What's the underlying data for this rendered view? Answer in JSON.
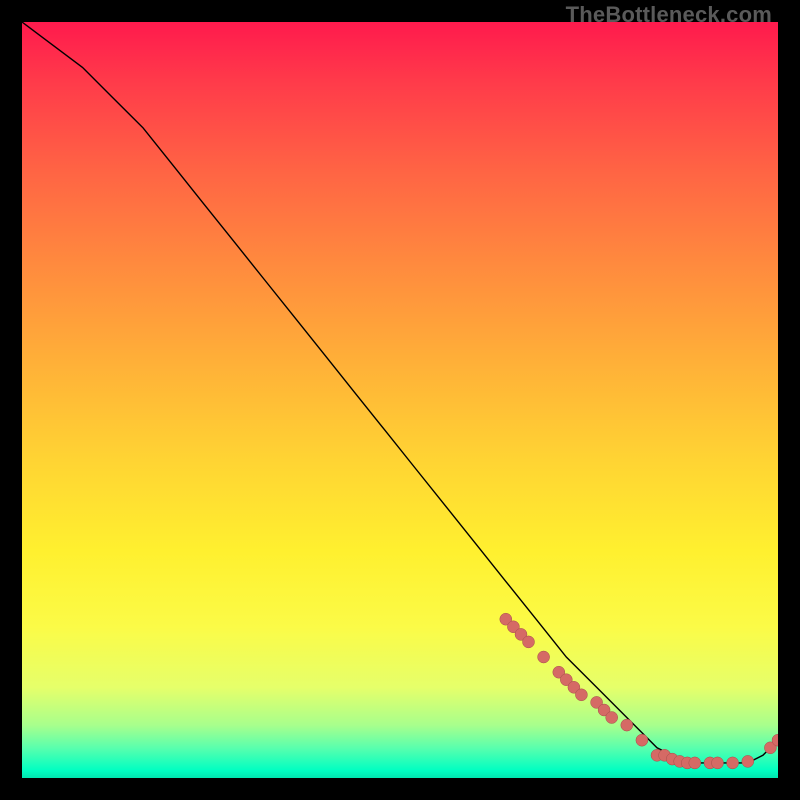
{
  "watermark": "TheBottleneck.com",
  "chart_data": {
    "type": "line",
    "title": "",
    "xlabel": "",
    "ylabel": "",
    "xlim": [
      0,
      100
    ],
    "ylim": [
      0,
      100
    ],
    "series": [
      {
        "name": "curve",
        "x": [
          0,
          4,
          8,
          12,
          16,
          20,
          24,
          28,
          32,
          36,
          40,
          44,
          48,
          52,
          56,
          60,
          64,
          68,
          72,
          76,
          80,
          82,
          84,
          86,
          88,
          90,
          92,
          94,
          96,
          98,
          100
        ],
        "y": [
          100,
          97,
          94,
          90,
          86,
          81,
          76,
          71,
          66,
          61,
          56,
          51,
          46,
          41,
          36,
          31,
          26,
          21,
          16,
          12,
          8,
          6,
          4,
          3,
          2,
          2,
          2,
          2,
          2,
          3,
          5
        ]
      }
    ],
    "dotted_region_start_x": 64,
    "points": [
      {
        "x": 64,
        "y": 21
      },
      {
        "x": 65,
        "y": 20
      },
      {
        "x": 66,
        "y": 19
      },
      {
        "x": 67,
        "y": 18
      },
      {
        "x": 69,
        "y": 16
      },
      {
        "x": 71,
        "y": 14
      },
      {
        "x": 72,
        "y": 13
      },
      {
        "x": 73,
        "y": 12
      },
      {
        "x": 74,
        "y": 11
      },
      {
        "x": 76,
        "y": 10
      },
      {
        "x": 77,
        "y": 9
      },
      {
        "x": 78,
        "y": 8
      },
      {
        "x": 80,
        "y": 7
      },
      {
        "x": 82,
        "y": 5
      },
      {
        "x": 84,
        "y": 3
      },
      {
        "x": 85,
        "y": 3
      },
      {
        "x": 86,
        "y": 2.5
      },
      {
        "x": 87,
        "y": 2.2
      },
      {
        "x": 88,
        "y": 2
      },
      {
        "x": 89,
        "y": 2
      },
      {
        "x": 91,
        "y": 2
      },
      {
        "x": 92,
        "y": 2
      },
      {
        "x": 94,
        "y": 2
      },
      {
        "x": 96,
        "y": 2.2
      },
      {
        "x": 99,
        "y": 4
      },
      {
        "x": 100,
        "y": 5
      }
    ]
  }
}
